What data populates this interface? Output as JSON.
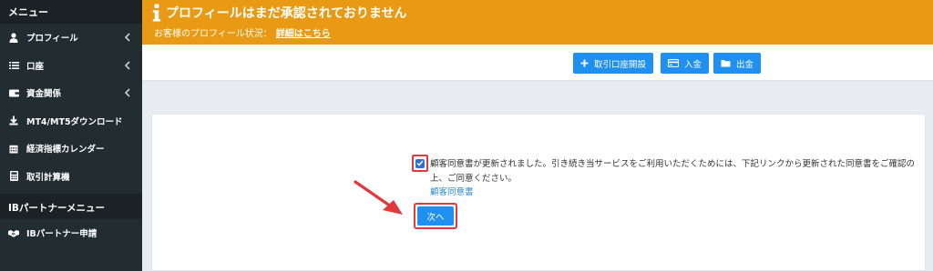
{
  "sidebar": {
    "header": "メニュー",
    "items": [
      {
        "label": "プロフィール",
        "icon": "user-icon",
        "has_chevron": true
      },
      {
        "label": "口座",
        "icon": "list-icon",
        "has_chevron": true
      },
      {
        "label": "資金関係",
        "icon": "wallet-icon",
        "has_chevron": true
      },
      {
        "label": "MT4/MT5ダウンロード",
        "icon": "download-icon",
        "has_chevron": false
      },
      {
        "label": "経済指標カレンダー",
        "icon": "calendar-icon",
        "has_chevron": false
      },
      {
        "label": "取引計算機",
        "icon": "calculator-icon",
        "has_chevron": false
      }
    ],
    "partner_header": "IBパートナーメニュー",
    "partner_items": [
      {
        "label": "IBパートナー申請",
        "icon": "handshake-icon"
      }
    ]
  },
  "banner": {
    "title": "プロフィールはまだ承認されておりません",
    "status_label": "お客様のプロフィール状況：",
    "status_link": "詳細はこちら",
    "color": "#e89a14"
  },
  "toolbar": {
    "open_account_label": "取引口座開設",
    "deposit_label": "入金",
    "withdraw_label": "出金",
    "button_color": "#1f8ff0"
  },
  "consent": {
    "checked": true,
    "text": "顧客同意書が更新されました。引き続き当サービスをご利用いただくためには、下記リンクから更新された同意書をご確認の上、ご同意ください。",
    "link_label": "顧客同意書",
    "next_label": "次へ",
    "highlight_color": "#e0393e"
  }
}
